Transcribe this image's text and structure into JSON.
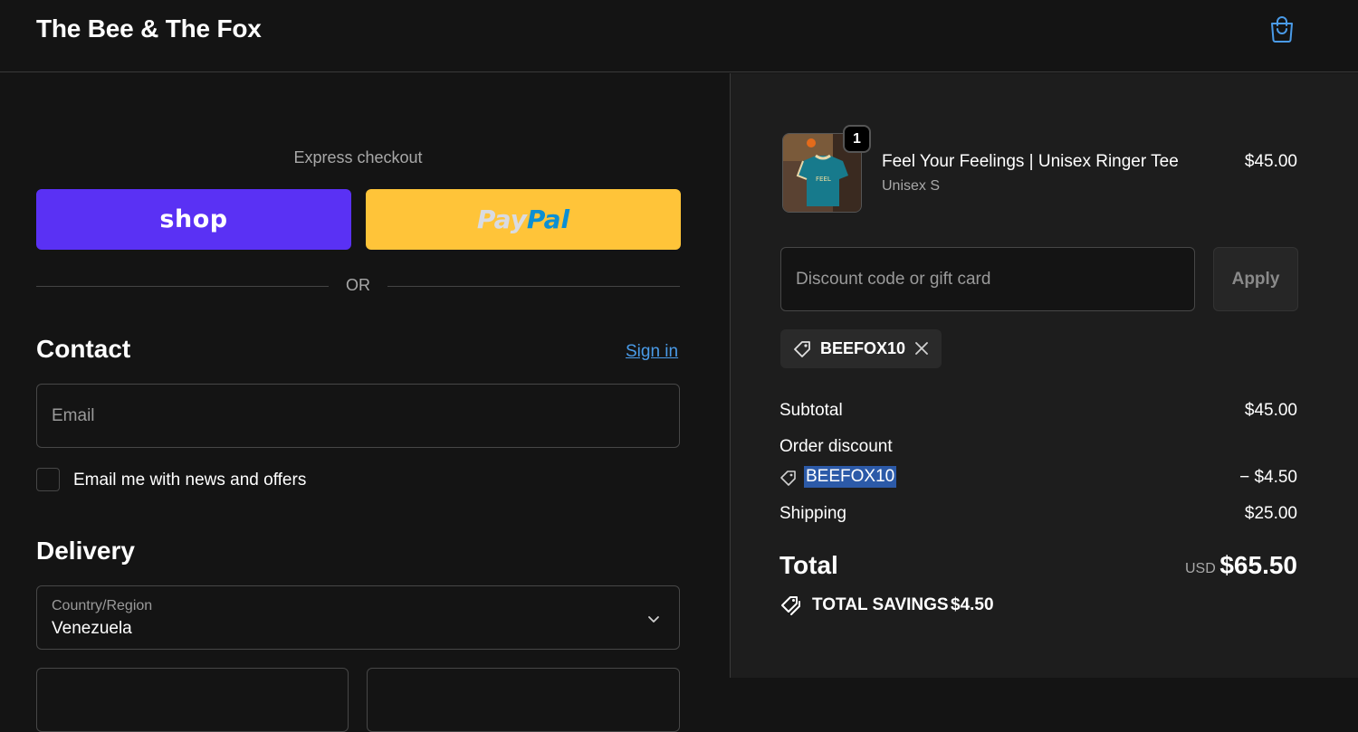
{
  "header": {
    "store_name": "The Bee & The Fox",
    "cart_icon": "shopping-bag-icon",
    "accent_color": "#4a9be8"
  },
  "express": {
    "label": "Express checkout",
    "shop_label": "shop",
    "paypal_pay": "Pay",
    "paypal_pal": "Pal",
    "or_label": "OR"
  },
  "contact": {
    "title": "Contact",
    "signin_label": "Sign in",
    "email_placeholder": "Email",
    "newsletter_label": "Email me with news and offers"
  },
  "delivery": {
    "title": "Delivery",
    "country_label": "Country/Region",
    "country_value": "Venezuela"
  },
  "order": {
    "item": {
      "name": "Feel Your Feelings | Unisex Ringer Tee",
      "variant": "Unisex S",
      "price": "$45.00",
      "quantity": "1"
    },
    "discount_placeholder": "Discount code or gift card",
    "apply_label": "Apply",
    "applied_code": "BEEFOX10",
    "subtotal_label": "Subtotal",
    "subtotal_value": "$45.00",
    "order_discount_label": "Order discount",
    "discount_code": "BEEFOX10",
    "discount_value": "− $4.50",
    "shipping_label": "Shipping",
    "shipping_value": "$25.00",
    "total_label": "Total",
    "currency": "USD",
    "total_value": "$65.50",
    "savings_label": "TOTAL SAVINGS",
    "savings_value": "$4.50"
  }
}
